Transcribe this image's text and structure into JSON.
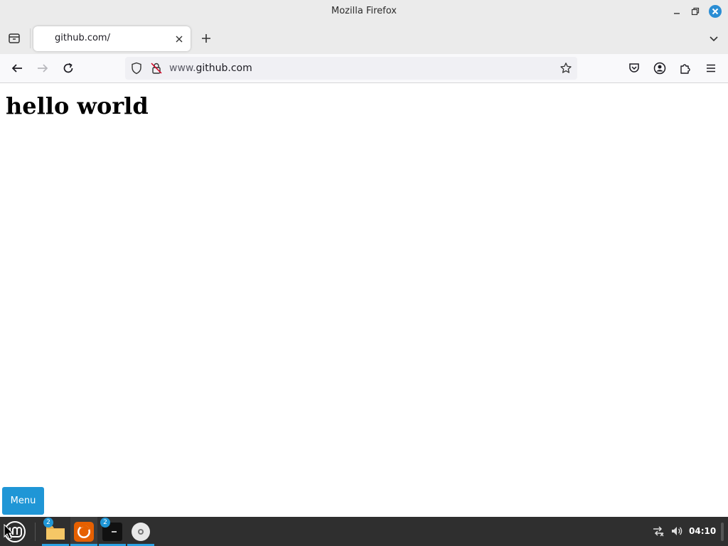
{
  "window": {
    "title": "Mozilla Firefox"
  },
  "tabs": [
    {
      "title": "github.com/",
      "active": true
    }
  ],
  "navbar": {
    "url_prefix": "www.",
    "url_host": "github.com"
  },
  "page": {
    "heading": "hello world"
  },
  "overlay": {
    "menu_label": "Menu"
  },
  "taskbar": {
    "apps": [
      {
        "name": "files",
        "badge": "2"
      },
      {
        "name": "firefox",
        "badge": ""
      },
      {
        "name": "terminal",
        "badge": "2"
      },
      {
        "name": "disc",
        "badge": ""
      }
    ],
    "clock": "04:10"
  },
  "colors": {
    "accent": "#1f96d6",
    "firefox": "#e66000",
    "close_button": "#2a8dd4"
  }
}
